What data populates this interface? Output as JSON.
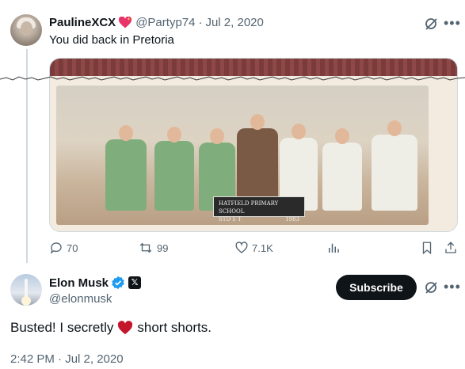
{
  "parent_tweet": {
    "display_name": "PaulineXCX",
    "badge_icon": "sparkling-heart-icon",
    "handle": "@Partyp74",
    "separator": "·",
    "date": "Jul 2, 2020",
    "text": "You did back in Pretoria",
    "photo": {
      "sign_line1": "HATFIELD PRIMARY SCHOOL",
      "sign_std": "STD 5 T",
      "sign_year": "1983"
    },
    "stats": {
      "replies": "70",
      "reposts": "99",
      "likes": "7.1K"
    }
  },
  "main_tweet": {
    "display_name": "Elon Musk",
    "x_badge": "𝕏",
    "handle": "@elonmusk",
    "subscribe_label": "Subscribe",
    "text_before": "Busted! I secretly",
    "text_after": "short shorts.",
    "timestamp": "2:42 PM · Jul 2, 2020"
  },
  "colors": {
    "text_primary": "#0f1419",
    "text_secondary": "#536471",
    "verified_blue": "#1d9bf0",
    "heart_red": "#c4162a"
  }
}
